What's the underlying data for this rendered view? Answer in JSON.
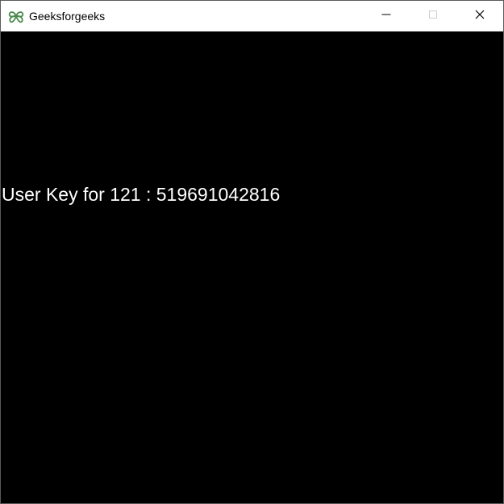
{
  "window": {
    "title": "Geeksforgeeks",
    "icon": "geeksforgeeks-logo-icon",
    "controls": {
      "minimize_icon": "minimize-icon",
      "maximize_icon": "maximize-icon",
      "close_icon": "close-icon"
    }
  },
  "content": {
    "message": "User Key for 121 : 519691042816",
    "background_color": "#000000",
    "text_color": "#ffffff"
  }
}
